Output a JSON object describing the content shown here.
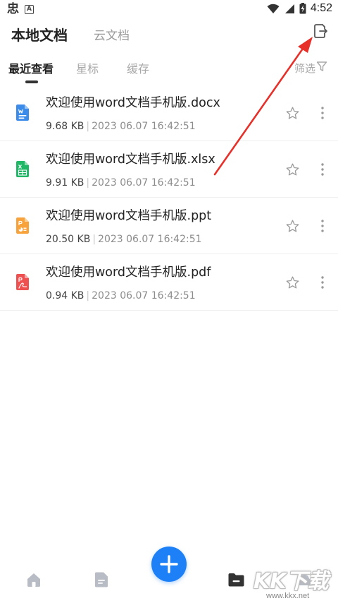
{
  "status_bar": {
    "app_icon_1": "忠",
    "app_icon_2": "A",
    "time": "4:52"
  },
  "header": {
    "tabs": [
      {
        "label": "本地文档",
        "active": true
      },
      {
        "label": "云文档",
        "active": false
      }
    ]
  },
  "subtabs": {
    "items": [
      {
        "label": "最近查看",
        "active": true
      },
      {
        "label": "星标"
      },
      {
        "label": "缓存"
      }
    ],
    "filter_label": "筛选"
  },
  "files": [
    {
      "name": "欢迎使用word文档手机版.docx",
      "size": "9.68 KB",
      "time": "2023 06.07 16:42:51",
      "type": "docx",
      "color": "#3b8beb"
    },
    {
      "name": "欢迎使用word文档手机版.xlsx",
      "size": "9.91 KB",
      "time": "2023 06.07 16:42:51",
      "type": "xlsx",
      "color": "#20b866"
    },
    {
      "name": "欢迎使用word文档手机版.ppt",
      "size": "20.50 KB",
      "time": "2023 06.07 16:42:51",
      "type": "ppt",
      "color": "#f7a23a"
    },
    {
      "name": "欢迎使用word文档手机版.pdf",
      "size": "0.94 KB",
      "time": "2023 06.07 16:42:51",
      "type": "pdf",
      "color": "#ef5050"
    }
  ],
  "meta_separator": "|",
  "colors": {
    "accent": "#1e80f6",
    "arrow": "#e8302a"
  },
  "icons": {
    "nav": [
      "home-icon",
      "document-icon",
      "add-icon",
      "folder-icon",
      "cloud-icon"
    ],
    "header": "export-icon"
  },
  "watermark": {
    "brand": "KK下载",
    "site": "www.kkx.net"
  }
}
